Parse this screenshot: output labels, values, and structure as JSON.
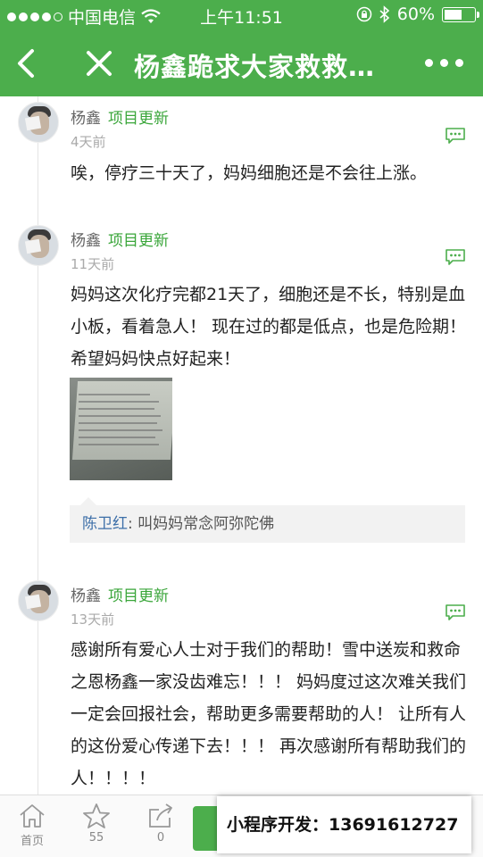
{
  "status_bar": {
    "carrier": "中国电信",
    "time": "上午11:51",
    "battery": "60%",
    "battery_level": 0.6
  },
  "nav": {
    "title": "杨鑫跪求大家救救…",
    "back_icon": "chevron-left-icon",
    "close_icon": "close-icon",
    "more_icon": "more-dots-icon"
  },
  "posts": [
    {
      "author": "杨鑫",
      "tag": "项目更新",
      "time": "4天前",
      "text": "唉，停疗三十天了，妈妈细胞还是不会往上涨。"
    },
    {
      "author": "杨鑫",
      "tag": "项目更新",
      "time": "11天前",
      "text": "妈妈这次化疗完都21天了，细胞还是不长，特别是血小板，看着急人！ 现在过的都是低点，也是危险期！ 希望妈妈快点好起来！",
      "reply": {
        "name": "陈卫红",
        "text": ": 叫妈妈常念阿弥陀佛"
      }
    },
    {
      "author": "杨鑫",
      "tag": "项目更新",
      "time": "13天前",
      "text": "感谢所有爱心人士对于我们的帮助！雪中送炭和救命之恩杨鑫一家没齿难忘！！！ 妈妈度过这次难关我们一定会回报社会，帮助更多需要帮助的人！ 让所有人的这份爱心传递下去！！！ 再次感谢所有帮助我们的人！！！！"
    }
  ],
  "tabbar": {
    "home_label": "首页",
    "like_count": "55",
    "share_count": "0"
  },
  "banner": {
    "text": "小程序开发：13691612727"
  },
  "colors": {
    "brand_green": "#4cae4c",
    "tag_green": "#3aa63a",
    "reply_name_blue": "#3d6fa8"
  }
}
